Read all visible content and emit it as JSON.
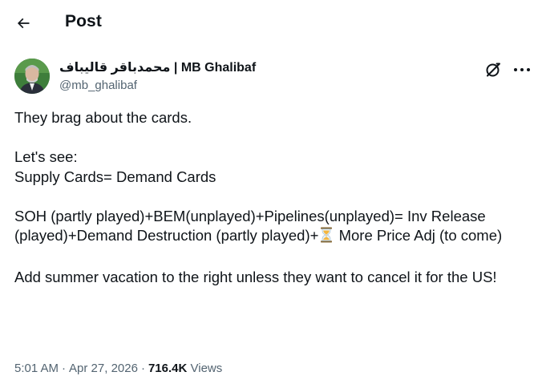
{
  "header": {
    "title": "Post",
    "back_icon": "arrow-left-icon"
  },
  "author": {
    "display_name": "محمدباقر قالیباف | MB Ghalibaf",
    "handle": "@mb_ghalibaf",
    "avatar_icon": "avatar"
  },
  "actions": {
    "grok_icon": "grok-icon",
    "more_icon": "more-icon"
  },
  "tweet": {
    "line1": "They brag about the cards.",
    "line2a": "Let's see:",
    "line2b": "Supply Cards= Demand Cards",
    "line3_before": "SOH (partly played)+BEM(unplayed)+Pipelines(unplayed)= Inv Release (played)+Demand Destruction (partly played)+",
    "line3_after": " More Price Adj (to come)",
    "line4": "Add summer vacation to the right unless they want to cancel it for the US!",
    "emoji_icon": "hourglass-icon"
  },
  "meta": {
    "time": "5:01 AM",
    "separator": "·",
    "date": "Apr 27, 2026",
    "views_count": "716.4K",
    "views_label": "Views"
  },
  "colors": {
    "text": "#0f1419",
    "secondary": "#536471",
    "background": "#ffffff"
  }
}
